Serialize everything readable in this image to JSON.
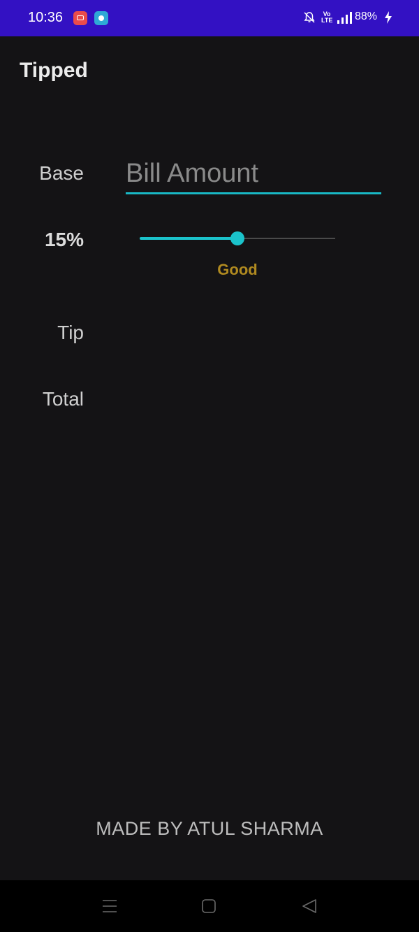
{
  "status_bar": {
    "time": "10:36",
    "volte_label": "Vo\nLTE",
    "battery": "88%"
  },
  "app": {
    "title": "Tipped"
  },
  "form": {
    "base_label": "Base",
    "bill_placeholder": "Bill Amount",
    "bill_value": "",
    "percent_label": "15%",
    "slider_fraction": 0.5,
    "tip_description": "Good",
    "tip_label": "Tip",
    "tip_value": "",
    "total_label": "Total",
    "total_value": ""
  },
  "footer": {
    "credit": "MADE BY ATUL SHARMA"
  },
  "colors": {
    "status_bar": "#3311c3",
    "background": "#141315",
    "accent": "#1bc3cb",
    "tip_description": "#b08a20"
  },
  "icons": {
    "notification_1": "screen-recorder-icon",
    "notification_2": "chat-bubble-icon",
    "mute": "bell-off-icon",
    "signal": "signal-icon",
    "charging": "bolt-icon",
    "nav_menu": "menu-icon",
    "nav_home": "home-icon",
    "nav_back": "back-icon"
  }
}
